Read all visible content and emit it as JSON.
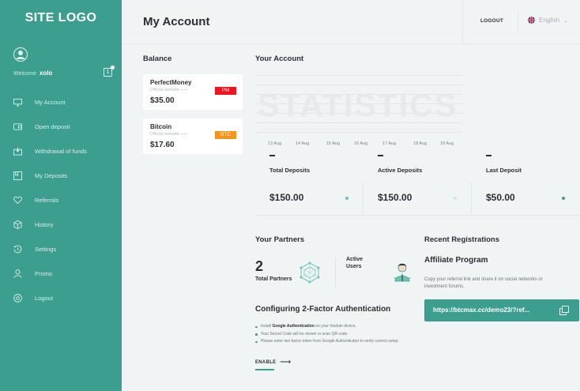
{
  "sidebar": {
    "logo": "SITE LOGO",
    "welcome_text": "Welcome",
    "username": "xolo",
    "notification_count": "1",
    "items": [
      {
        "label": "My Account",
        "icon": "monitor-icon"
      },
      {
        "label": "Open deposit",
        "icon": "wallet-icon"
      },
      {
        "label": "Withdrawal of funds",
        "icon": "withdraw-icon"
      },
      {
        "label": "My Deposits",
        "icon": "deposits-icon"
      },
      {
        "label": "Referrals",
        "icon": "heart-icon"
      },
      {
        "label": "History",
        "icon": "history-icon"
      },
      {
        "label": "Settings",
        "icon": "settings-icon"
      },
      {
        "label": "Promo",
        "icon": "promo-icon"
      },
      {
        "label": "Logout",
        "icon": "logout-icon"
      }
    ]
  },
  "header": {
    "title": "My Account",
    "logout": "LOGOUT",
    "language": "English"
  },
  "balance": {
    "title": "Balance",
    "cards": [
      {
        "name": "PerfectMoney",
        "subtitle": "Official website",
        "amount": "$35.00",
        "badge": "PM",
        "badge_color": "#f0141e"
      },
      {
        "name": "Bitcoin",
        "subtitle": "Official website",
        "amount": "$17.60",
        "badge": "BTC",
        "badge_color": "#f7931a"
      }
    ]
  },
  "account": {
    "title": "Your Account",
    "watermark": "STATISTICS",
    "dates": [
      "13 Aug",
      "14 Aug",
      "15 Aug",
      "16 Aug",
      "17 Aug",
      "18 Aug",
      "19 Aug"
    ],
    "stats": [
      {
        "label": "Total Deposits",
        "value": "$150.00",
        "dot_color": "#6cc4b1"
      },
      {
        "label": "Active Deposits",
        "value": "$150.00",
        "dot_color": "#cfe6e1"
      },
      {
        "label": "Last Deposit",
        "value": "$50.00",
        "dot_color": "#3c9e8f"
      }
    ]
  },
  "partners": {
    "title": "Your Partners",
    "total_count": "2",
    "total_label": "Total Partners",
    "active_label": "Active Users"
  },
  "tfa": {
    "title": "Configuring 2-Factor Authentication",
    "steps": [
      {
        "prefix": "Install ",
        "bold": "Google Authentication",
        "suffix": " on your module device."
      },
      {
        "prefix": "Your Secret Code will be shown or scan QR code.",
        "bold": "",
        "suffix": ""
      },
      {
        "prefix": "Please enter two factor token from Google Authenticator to verify correct setup:",
        "bold": "",
        "suffix": ""
      }
    ],
    "enable_label": "ENABLE"
  },
  "recent": {
    "title": "Recent Registrations"
  },
  "affiliate": {
    "title": "Affiliate Program",
    "description": "Copy your referral link and share it on social networks or investment forums.",
    "link": "https://btcmax.cc/demo23/?ref..."
  },
  "colors": {
    "accent": "#3c9e8f",
    "background": "#f1f4f4"
  }
}
